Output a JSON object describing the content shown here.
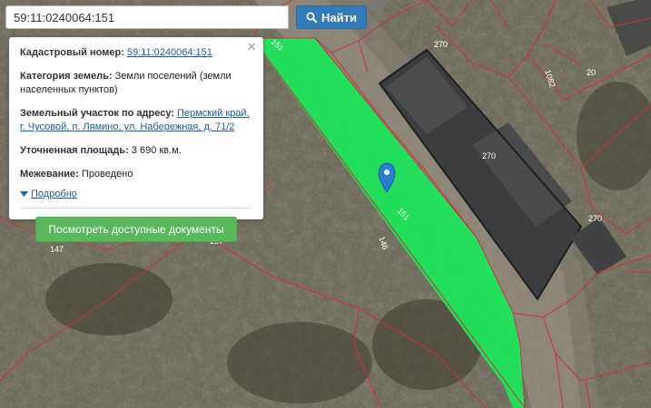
{
  "search": {
    "value": "59:11:0240064:151",
    "button_label": "Найти"
  },
  "popup": {
    "cadastral_label": "Кадастровый номер:",
    "cadastral_value": "59:11:0240064:151",
    "category_label": "Категория земель:",
    "category_value": "Земли поселений (земли населенных пунктов)",
    "address_label": "Земельный участок по адресу:",
    "address_value": "Пермский край, г. Чусовой, п. Лямино, ул. Набережная, д. 71/2",
    "area_label": "Уточненная площадь:",
    "area_value": "3 690 кв.м.",
    "survey_label": "Межевание:",
    "survey_value": "Проведено",
    "more_label": "Подробно",
    "docs_button_label": "Посмотреть доступные документы",
    "close_symbol": "×"
  },
  "map": {
    "parcel_labels": [
      "151",
      "270",
      "1082",
      "20",
      "270",
      "270",
      "157",
      "147",
      "146",
      "151"
    ],
    "colors": {
      "parcel_highlight": "#1fe45a",
      "parcel_border": "#c8343c",
      "marker": "#2a7fd4"
    }
  }
}
